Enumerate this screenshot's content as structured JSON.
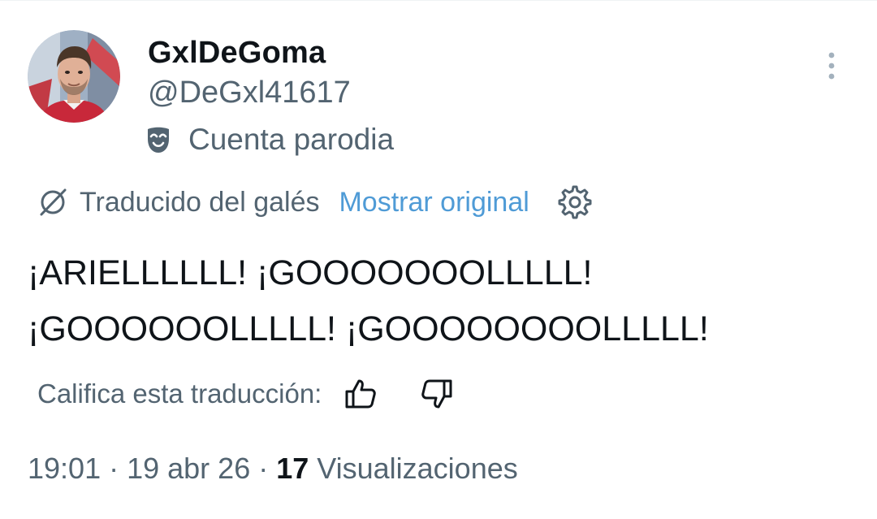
{
  "author": {
    "display_name": "GxlDeGoma",
    "handle": "@DeGxl41617",
    "label": "Cuenta parodia",
    "label_icon": "theater-mask-icon",
    "avatar": "profile-photo"
  },
  "translation": {
    "status": "Traducido del galés",
    "show_original": "Mostrar original",
    "status_icon": "translate-icon",
    "settings_icon": "gear-icon",
    "link_color": "#4f9bd6"
  },
  "tweet": {
    "lines": [
      "¡ARIELLLLLL! ¡GOOOOOOOLLLLL!",
      "¡GOOOOOOLLLLL! ¡GOOOOOOOOLLLLL!"
    ]
  },
  "rating": {
    "prompt": "Califica esta traducción:",
    "up_icon": "thumbs-up-icon",
    "down_icon": "thumbs-down-icon"
  },
  "meta": {
    "time": "19:01",
    "separator": "·",
    "date": "19 abr 26",
    "views_count": "17",
    "views_label": "Visualizaciones"
  },
  "menu_icon": "more-vertical-icon",
  "colors": {
    "primary_text": "#0f1419",
    "secondary_text": "#536471"
  }
}
